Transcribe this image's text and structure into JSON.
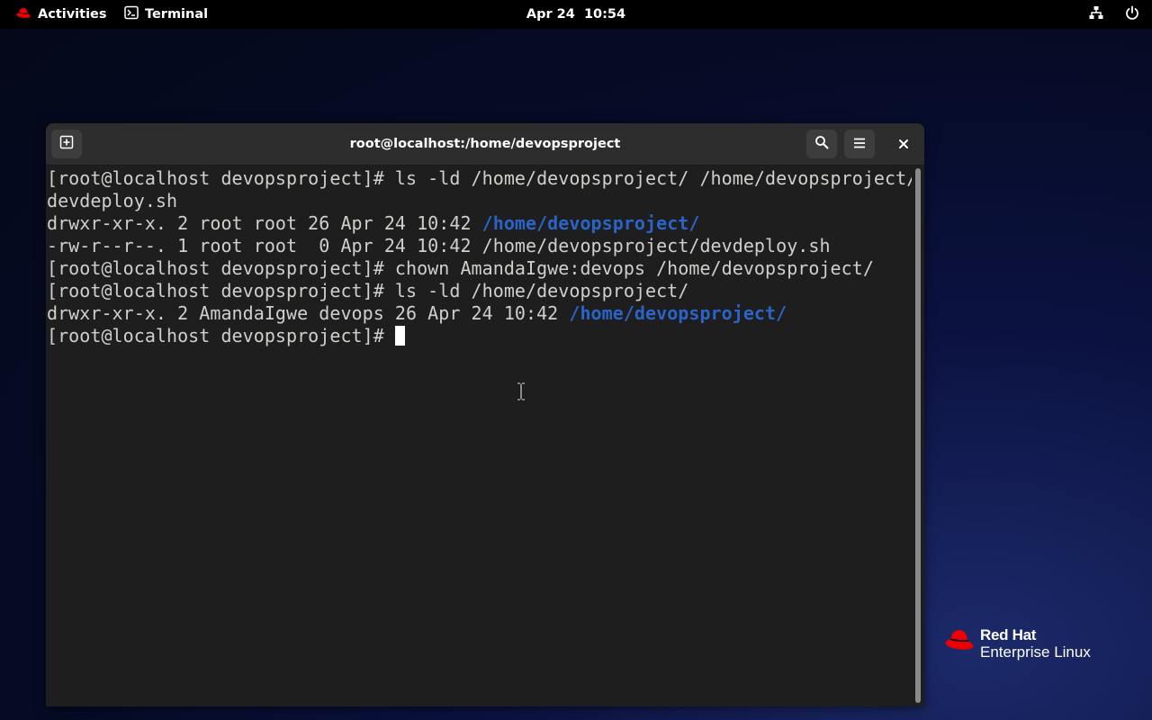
{
  "topbar": {
    "activities_label": "Activities",
    "app_label": "Terminal",
    "clock": "Apr 24  10:54",
    "icons": [
      "redhat-logo-icon",
      "terminal-icon",
      "network-icon",
      "power-icon"
    ]
  },
  "window": {
    "title": "root@localhost:/home/devopsproject",
    "buttons": [
      "new-tab-icon",
      "search-icon",
      "menu-icon",
      "close-icon"
    ]
  },
  "terminal": {
    "lines": [
      [
        {
          "t": "[root@localhost devopsproject]# ls -ld /home/devopsproject/ /home/devopsproject/",
          "c": "normal"
        }
      ],
      [
        {
          "t": "devdeploy.sh",
          "c": "normal"
        }
      ],
      [
        {
          "t": "drwxr-xr-x. 2 root root 26 Apr 24 10:42 ",
          "c": "normal"
        },
        {
          "t": "/home/devopsproject/",
          "c": "dir"
        }
      ],
      [
        {
          "t": "-rw-r--r--. 1 root root  0 Apr 24 10:42 /home/devopsproject/devdeploy.sh",
          "c": "normal"
        }
      ],
      [
        {
          "t": "[root@localhost devopsproject]# chown AmandaIgwe:devops /home/devopsproject/",
          "c": "normal"
        }
      ],
      [
        {
          "t": "[root@localhost devopsproject]# ls -ld /home/devopsproject/",
          "c": "normal"
        }
      ],
      [
        {
          "t": "drwxr-xr-x. 2 AmandaIgwe devops 26 Apr 24 10:42 ",
          "c": "normal"
        },
        {
          "t": "/home/devopsproject/",
          "c": "dir"
        }
      ],
      [
        {
          "t": "[root@localhost devopsproject]# ",
          "c": "normal"
        }
      ]
    ],
    "colors": {
      "text": "#d0cfcc",
      "dir": "#2a64c8",
      "background": "#1e1e1e"
    }
  },
  "branding": {
    "line1": "Red Hat",
    "line2": "Enterprise Linux",
    "logo_color": "#ee0000"
  }
}
